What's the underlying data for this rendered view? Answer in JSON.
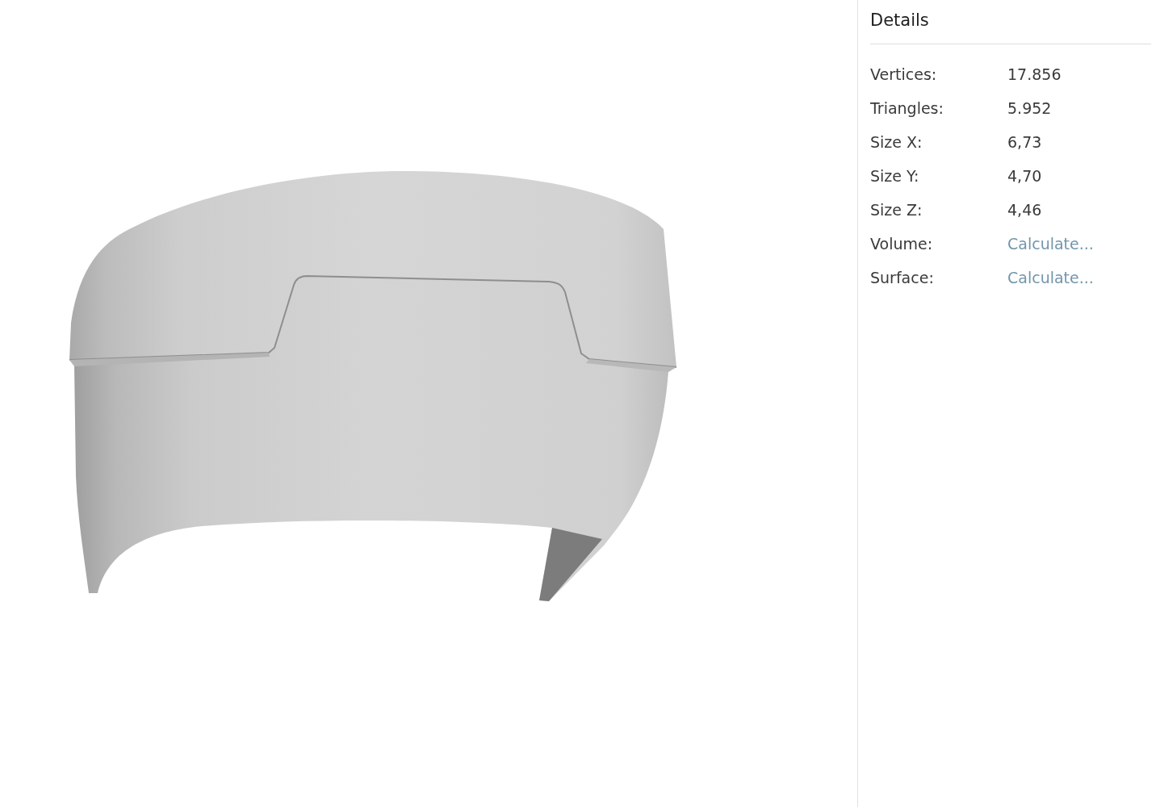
{
  "details": {
    "title": "Details",
    "rows": [
      {
        "label": "Vertices:",
        "value": "17.856",
        "kind": "text"
      },
      {
        "label": "Triangles:",
        "value": "5.952",
        "kind": "text"
      },
      {
        "label": "Size X:",
        "value": "6,73",
        "kind": "text"
      },
      {
        "label": "Size Y:",
        "value": "4,70",
        "kind": "text"
      },
      {
        "label": "Size Z:",
        "value": "4,46",
        "kind": "text"
      },
      {
        "label": "Volume:",
        "value": "Calculate...",
        "kind": "link"
      },
      {
        "label": "Surface:",
        "value": "Calculate...",
        "kind": "link"
      }
    ]
  }
}
